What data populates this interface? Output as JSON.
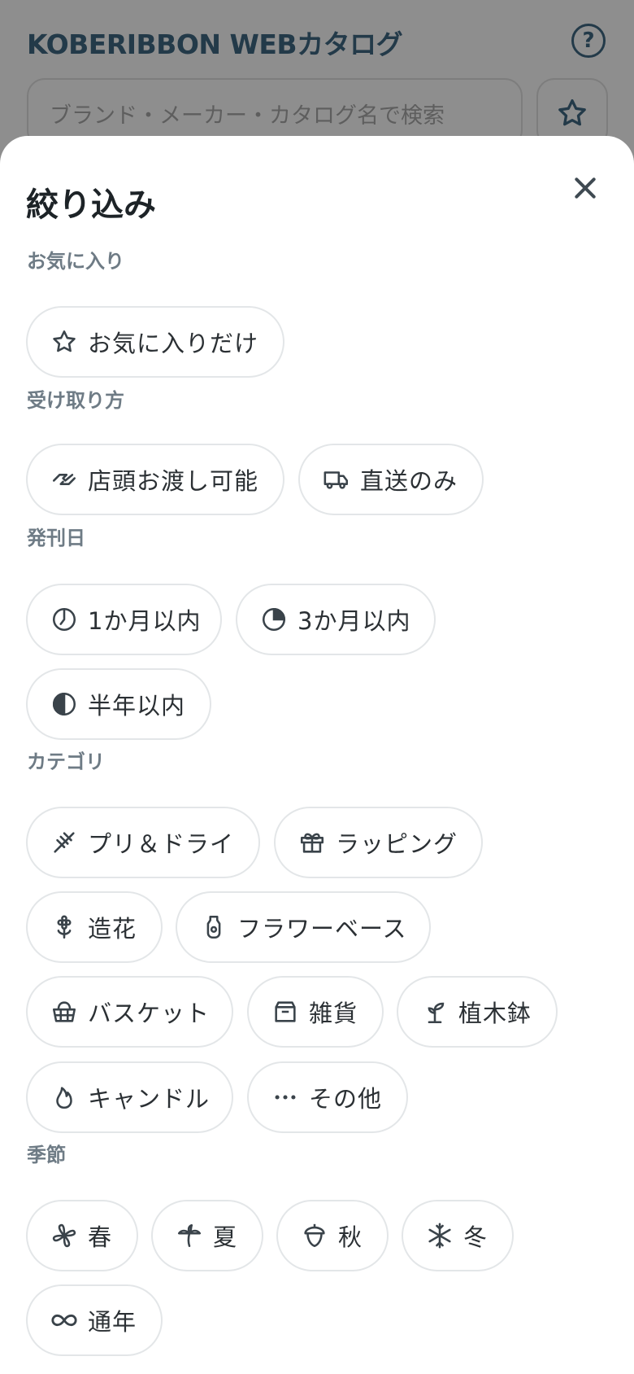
{
  "header": {
    "app_title": "KOBERIBBON WEBカタログ",
    "help_label": "?",
    "search_placeholder": "ブランド・メーカー・カタログ名で検索"
  },
  "filter_sheet": {
    "title": "絞り込み",
    "sections": {
      "favorites": {
        "label": "お気に入り",
        "chips": [
          "お気に入りだけ"
        ]
      },
      "receive": {
        "label": "受け取り方",
        "chips": [
          "店頭お渡し可能",
          "直送のみ"
        ]
      },
      "published": {
        "label": "発刊日",
        "chips": [
          "1か月以内",
          "3か月以内",
          "半年以内"
        ]
      },
      "category": {
        "label": "カテゴリ",
        "chips": [
          "プリ＆ドライ",
          "ラッピング",
          "造花",
          "フラワーベース",
          "バスケット",
          "雑貨",
          "植木鉢",
          "キャンドル",
          "その他"
        ]
      },
      "season": {
        "label": "季節",
        "chips": [
          "春",
          "夏",
          "秋",
          "冬",
          "通年"
        ]
      }
    }
  },
  "colors": {
    "title_text": "#233a49",
    "section_label": "#6e7b85",
    "chip_border": "#e3e6e8",
    "icon_stroke": "#3a434a",
    "overlay": "#8e8e8e"
  },
  "icons": {
    "help": "question-circle-icon",
    "favorite": "star-icon",
    "close": "close-icon",
    "store_pickup": "handshake-icon",
    "direct_ship": "truck-icon",
    "one_month": "clock-quarter-icon",
    "three_months": "pie-quarter-icon",
    "half_year": "half-circle-icon",
    "preserved_dried": "wheat-icon",
    "wrapping": "gift-icon",
    "artificial_flower": "flower-icon",
    "vase": "vase-icon",
    "basket": "basket-icon",
    "goods": "box-icon",
    "pot": "sprout-icon",
    "candle": "flame-icon",
    "other": "dots-icon",
    "spring": "clover-icon",
    "summer": "palm-icon",
    "autumn": "acorn-icon",
    "winter": "snowflake-icon",
    "all_year": "infinity-icon"
  }
}
